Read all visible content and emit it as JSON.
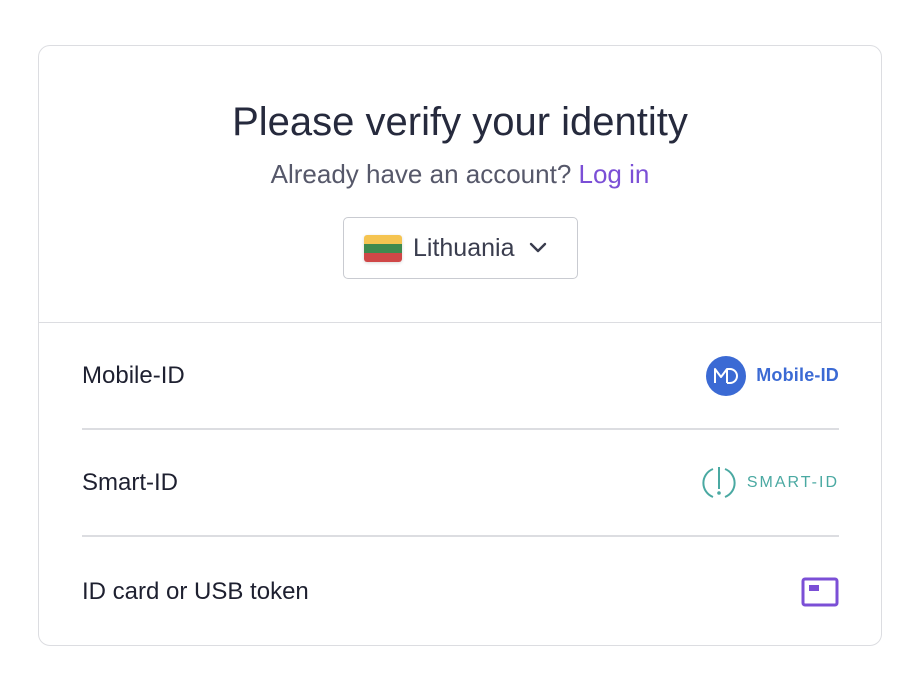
{
  "header": {
    "title": "Please verify your identity",
    "subtitle_prefix": "Already have an account?",
    "login_link": "Log in"
  },
  "country_select": {
    "selected": "Lithuania",
    "flag_colors": [
      "#FDB913",
      "#006A44",
      "#C1272D"
    ]
  },
  "methods": [
    {
      "label": "Mobile-ID",
      "logo_text": "Mobile-ID",
      "logo_icon": "mobile-id-logo-icon",
      "color": "#3b6ad4"
    },
    {
      "label": "Smart-ID",
      "logo_text": "SMART-ID",
      "logo_icon": "smart-id-logo-icon",
      "color": "#4aa9a2"
    },
    {
      "label": "ID card or USB token",
      "logo_icon": "id-card-icon",
      "color": "#7b4fd6"
    }
  ]
}
